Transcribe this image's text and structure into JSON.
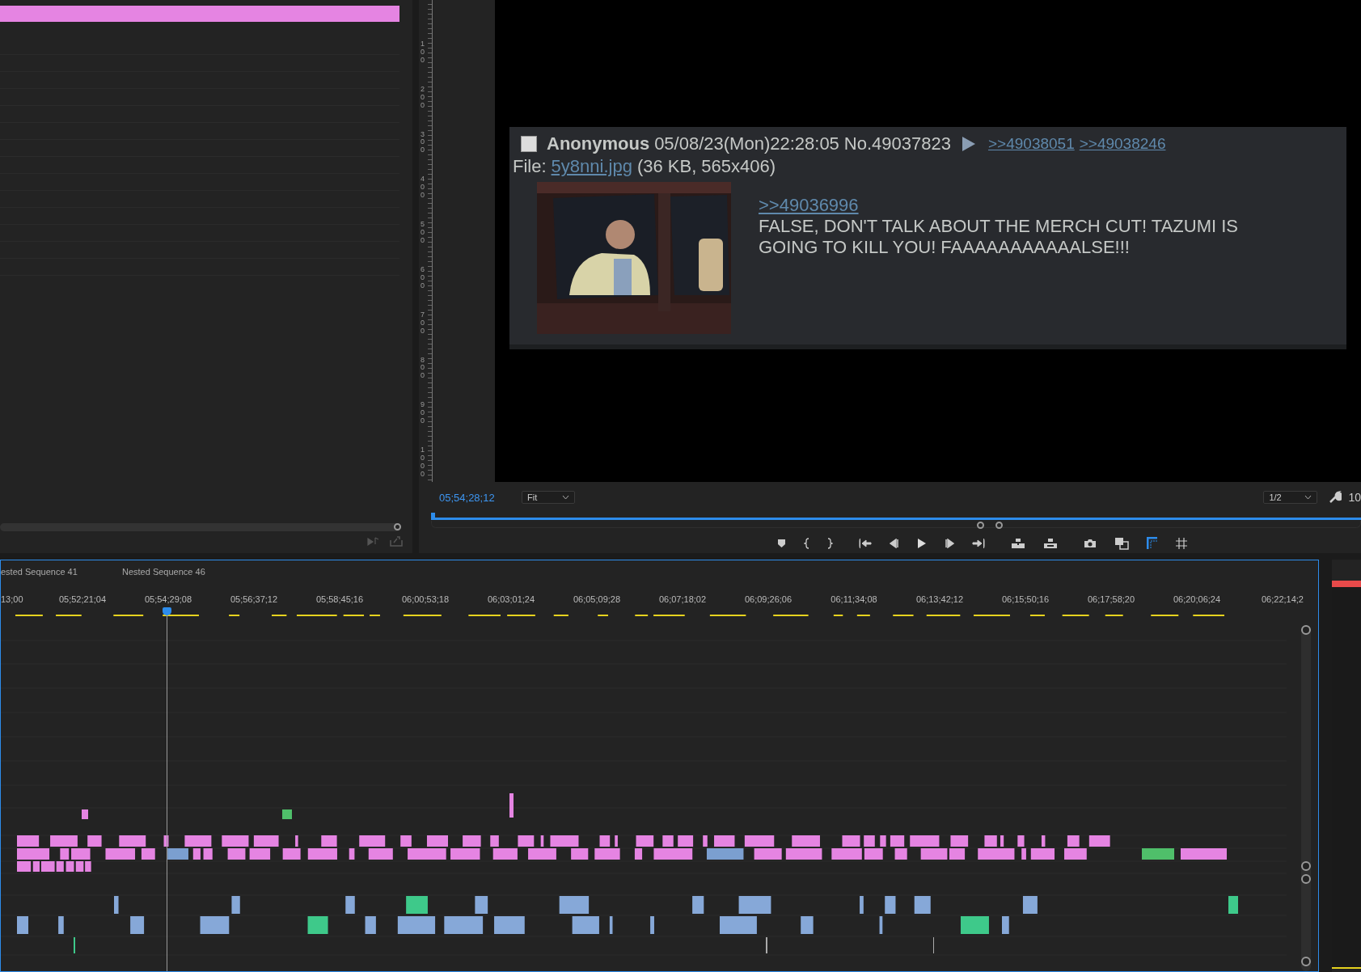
{
  "program_monitor": {
    "ruler_labels": [
      "100",
      "200",
      "300",
      "400",
      "500",
      "600",
      "700",
      "800",
      "900",
      "1000"
    ],
    "post": {
      "checked": false,
      "name": "Anonymous",
      "date": "05/08/23(Mon)22:28:05",
      "number": "No.49037823",
      "replies": [
        ">>49038051",
        ">>49038246"
      ],
      "file_label": "File:",
      "file_name": "5y8nni.jpg",
      "file_info": "(36 KB, 565x406)",
      "quote": ">>49036996",
      "comment": "FALSE, DON'T TALK ABOUT THE MERCH CUT! TAZUMI IS GOING TO KILL YOU! FAAAAAAAAAAALSE!!!"
    },
    "timecode": "05;54;28;12",
    "zoom_select": "Fit",
    "resolution_select": "1/2",
    "cut_label": "10"
  },
  "timeline": {
    "tabs": [
      {
        "label": "ested Sequence 41",
        "selected": false
      },
      {
        "label": "Nested Sequence 46",
        "selected": false
      }
    ],
    "ruler_labels": [
      "13;00",
      "05;52;21;04",
      "05;54;29;08",
      "05;56;37;12",
      "05;58;45;16",
      "06;00;53;18",
      "06;03;01;24",
      "06;05;09;28",
      "06;07;18;02",
      "06;09;26;06",
      "06;11;34;08",
      "06;13;42;12",
      "06;15;50;16",
      "06;17;58;20",
      "06;20;06;24",
      "06;22;14;2"
    ]
  }
}
